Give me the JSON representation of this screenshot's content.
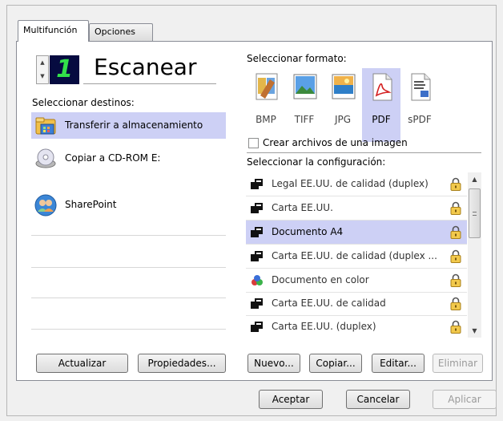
{
  "tabs": [
    {
      "label": "Multifunción",
      "active": true
    },
    {
      "label": "Opciones",
      "active": false
    }
  ],
  "scan": {
    "digit": "1",
    "title": "Escanear",
    "spinner_up": "▲",
    "spinner_down": "▼"
  },
  "destinations": {
    "label": "Seleccionar destinos:",
    "items": [
      {
        "label": "Transferir a almacenamiento",
        "icon": "storage-folder-icon",
        "selected": true
      },
      {
        "label": "Copiar a CD-ROM  E:",
        "icon": "cd-rom-icon",
        "selected": false
      },
      {
        "label": "SharePoint",
        "icon": "sharepoint-icon",
        "selected": false
      }
    ],
    "buttons": {
      "refresh": "Actualizar",
      "properties": "Propiedades..."
    }
  },
  "format": {
    "label": "Seleccionar formato:",
    "items": [
      {
        "label": "BMP",
        "icon": "bmp-icon",
        "selected": false
      },
      {
        "label": "TIFF",
        "icon": "tiff-icon",
        "selected": false
      },
      {
        "label": "JPG",
        "icon": "jpg-icon",
        "selected": false
      },
      {
        "label": "PDF",
        "icon": "pdf-icon",
        "selected": true
      },
      {
        "label": "sPDF",
        "icon": "spdf-icon",
        "selected": false
      }
    ],
    "single_image_checkbox": {
      "label": "Crear archivos de una imagen",
      "checked": false
    }
  },
  "configuration": {
    "label": "Seleccionar la configuración:",
    "items": [
      {
        "label": "Legal EE.UU. de calidad (duplex)",
        "icon": "scanner-bw-icon",
        "selected": false
      },
      {
        "label": "Carta EE.UU.",
        "icon": "scanner-bw-icon",
        "selected": false
      },
      {
        "label": "Documento A4",
        "icon": "scanner-bw-icon",
        "selected": true
      },
      {
        "label": "Carta EE.UU. de calidad (duplex ...",
        "icon": "scanner-bw-icon",
        "selected": false
      },
      {
        "label": "Documento en color",
        "icon": "color-document-icon",
        "selected": false
      },
      {
        "label": "Carta EE.UU. de calidad",
        "icon": "scanner-bw-icon",
        "selected": false
      },
      {
        "label": "Carta EE.UU. (duplex)",
        "icon": "scanner-bw-icon",
        "selected": false
      }
    ],
    "buttons": {
      "new": "Nuevo...",
      "copy": "Copiar...",
      "edit": "Editar...",
      "delete": "Eliminar"
    }
  },
  "dialog_buttons": {
    "ok": "Aceptar",
    "cancel": "Cancelar",
    "apply": "Aplicar"
  },
  "colors": {
    "selection": "#cdd0f5",
    "digit_bg": "#060b40",
    "digit_fg": "#32e04a",
    "lock": "#f2c94c"
  }
}
